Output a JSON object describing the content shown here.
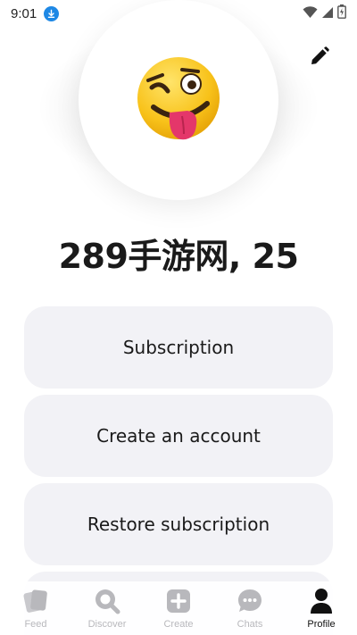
{
  "status_bar": {
    "time": "9:01",
    "icons": [
      "download-badge-icon",
      "wifi-icon",
      "signal-icon",
      "battery-icon"
    ]
  },
  "profile": {
    "avatar_emoji": "😜",
    "name": "289手游网, 25",
    "edit_icon": "pencil-icon"
  },
  "menu": {
    "items": [
      {
        "label": "Subscription"
      },
      {
        "label": "Create an account"
      },
      {
        "label": "Restore subscription"
      },
      {
        "label": ""
      }
    ]
  },
  "bottom_nav": {
    "items": [
      {
        "label": "Feed",
        "icon": "cards-icon"
      },
      {
        "label": "Discover",
        "icon": "search-icon"
      },
      {
        "label": "Create",
        "icon": "plus-square-icon"
      },
      {
        "label": "Chats",
        "icon": "chat-bubble-icon"
      },
      {
        "label": "Profile",
        "icon": "person-icon"
      }
    ],
    "active": "Profile"
  },
  "colors": {
    "card_bg": "#f2f2f6",
    "inactive_nav": "#b8b8bc",
    "active_nav": "#111111",
    "download_badge": "#1e88e5"
  }
}
